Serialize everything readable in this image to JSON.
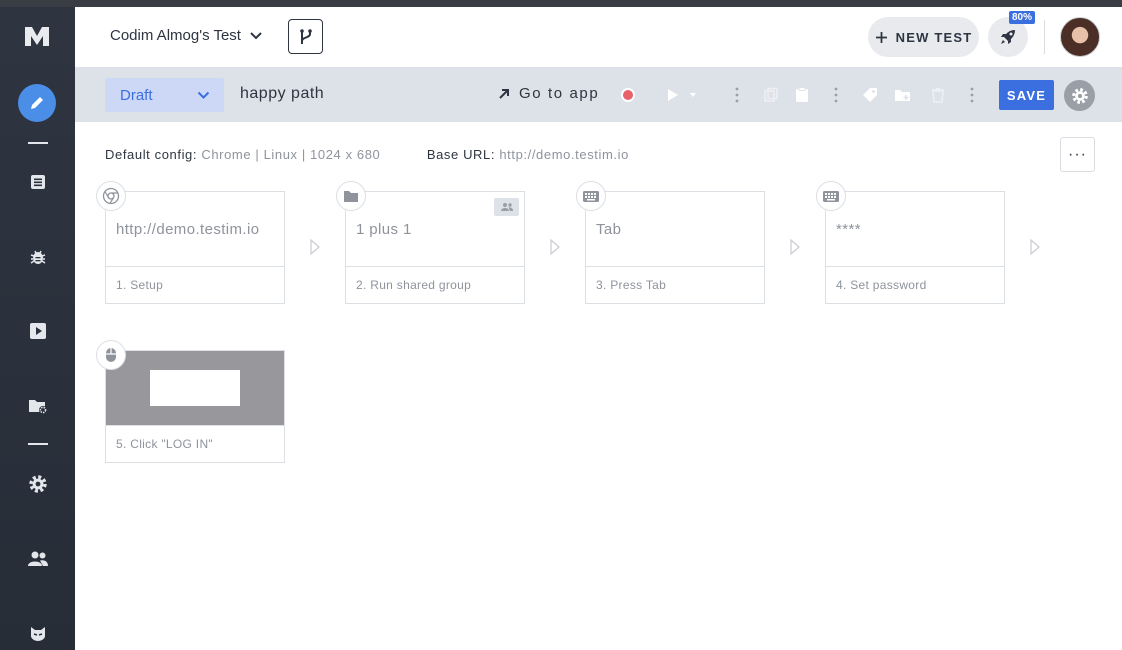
{
  "sidebar": {
    "items": [
      {
        "icon": "pencil-icon",
        "active": true
      },
      {
        "icon": "list-icon"
      },
      {
        "icon": "bug-icon"
      },
      {
        "icon": "play-icon"
      },
      {
        "icon": "folder-gear-icon"
      },
      {
        "icon": "gear-icon"
      },
      {
        "icon": "users-icon"
      },
      {
        "icon": "mascot-icon"
      }
    ]
  },
  "header": {
    "project_name": "Codim Almog's Test",
    "new_test_label": "NEW TEST",
    "progress_badge": "80%"
  },
  "toolbar": {
    "status": "Draft",
    "test_name": "happy path",
    "go_to_app": "Go to app",
    "save_label": "SAVE"
  },
  "config": {
    "default_config_label": "Default config:",
    "default_config_value": "Chrome | Linux | 1024 x 680",
    "base_url_label": "Base URL:",
    "base_url_value": "http://demo.testim.io",
    "more_label": "···"
  },
  "steps": [
    {
      "preview": "http://demo.testim.io",
      "label": "1. Setup",
      "icon": "chrome-icon"
    },
    {
      "preview": "1 plus 1",
      "label": "2. Run shared group",
      "icon": "folder-icon"
    },
    {
      "preview": "Tab",
      "label": "3. Press Tab",
      "icon": "keyboard-icon"
    },
    {
      "preview": "****",
      "label": "4. Set password",
      "icon": "keyboard-icon"
    },
    {
      "preview": "",
      "label": "5. Click \"LOG IN\"",
      "icon": "mouse-icon"
    }
  ],
  "colors": {
    "accent": "#3b6fe0",
    "sidebar": "#2e3541",
    "toolbar": "#dde1e8",
    "record": "#e8606a"
  }
}
